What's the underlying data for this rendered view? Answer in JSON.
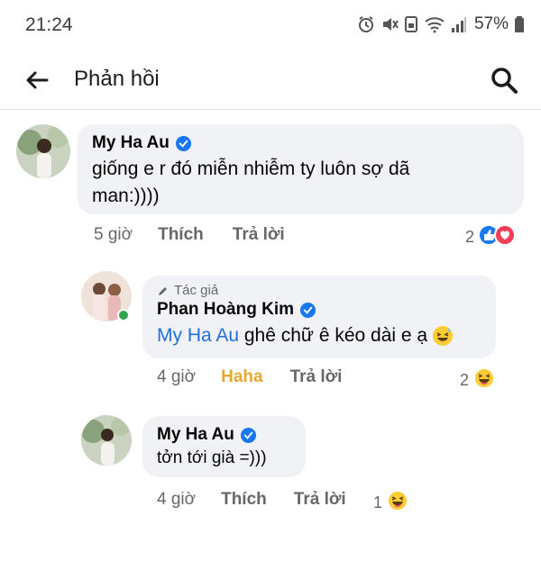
{
  "status_bar": {
    "time": "21:24",
    "battery": "57%"
  },
  "header": {
    "title": "Phản hồi"
  },
  "comments": [
    {
      "author": "My Ha Au",
      "verified": true,
      "text": "giống e r đó miễn nhiễm ty luôn sợ dã man:))))",
      "time": "5 giờ",
      "like_label": "Thích",
      "reply_label": "Trả lời",
      "reaction_count": "2",
      "reactions": [
        "like-icon",
        "love-icon"
      ]
    },
    {
      "author_tag": "Tác giả",
      "author": "Phan Hoàng Kim",
      "verified": true,
      "mention": "My Ha Au",
      "text": " ghê chữ ê kéo dài e ạ",
      "text_emoji": "grinning-sweat-emoji",
      "time": "4 giờ",
      "like_label": "Haha",
      "reply_label": "Trả lời",
      "reaction_count": "2",
      "reactions": [
        "haha-icon"
      ]
    },
    {
      "author": "My Ha Au",
      "verified": true,
      "text": "tởn tới già =)))",
      "time": "4 giờ",
      "like_label": "Thích",
      "reply_label": "Trả lời",
      "reaction_count": "1",
      "reactions": [
        "haha-icon"
      ]
    }
  ],
  "colors": {
    "accent": "#216fdb",
    "haha_active": "#e3a82d",
    "bubble": "#f0f2f5",
    "verified": "#1877f2"
  }
}
